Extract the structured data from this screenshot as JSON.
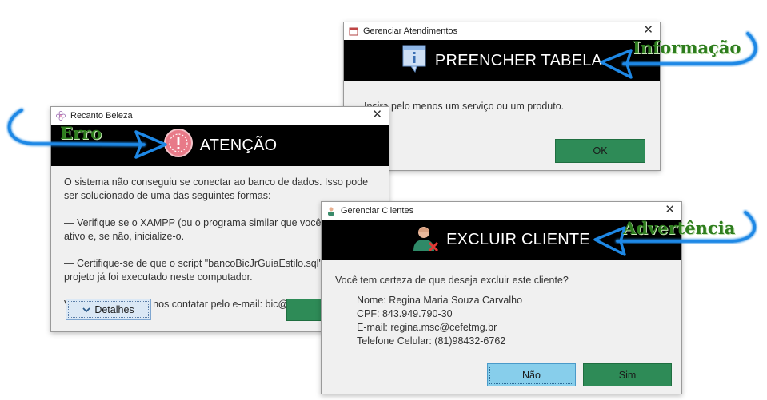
{
  "info_dialog": {
    "window_title": "Gerenciar Atendimentos",
    "banner_title": "PREENCHER TABELA",
    "message": "Insira pelo menos um serviço ou um produto.",
    "ok_label": "OK"
  },
  "error_dialog": {
    "window_title": "Recanto Beleza",
    "banner_title": "ATENÇÃO",
    "paragraphs": [
      "O sistema não conseguiu se conectar ao banco de dados. Isso pode ser solucionado de uma das seguintes formas:",
      "— Verifique se o XAMPP (ou o programa similar que você usa) está ativo e, se não, inicialize-o.",
      "— Certifique-se de que o script \"bancoBicJrGuiaEstilo.sql\" em anexo ao projeto já foi executado neste computador.",
      "Você também pode nos contatar pelo e-mail: bic@sistemas.com"
    ],
    "details_label": "Detalhes"
  },
  "warning_dialog": {
    "window_title": "Gerenciar Clientes",
    "banner_title": "EXCLUIR CLIENTE",
    "question": "Você tem certeza de que deseja excluir este cliente?",
    "client_fields": [
      "Nome: Regina Maria Souza Carvalho",
      "CPF: 843.949.790-30",
      "E-mail: regina.msc@cefetmg.br",
      "Telefone Celular: (81)98432-6762"
    ],
    "no_label": "Não",
    "yes_label": "Sim"
  },
  "callouts": {
    "info": "Informação",
    "error": "Erro",
    "warning": "Advertência"
  },
  "colors": {
    "banner_bg": "#000000",
    "button_green": "#2e8b57",
    "button_blue": "#87ceeb",
    "callout_text": "#2e7d1e",
    "arrow_blue": "#1e88e5"
  },
  "icons": {
    "info": "info-icon",
    "error": "error-icon",
    "warning": "user-remove-icon",
    "close": "close-icon",
    "details": "chevron-down-icon"
  }
}
